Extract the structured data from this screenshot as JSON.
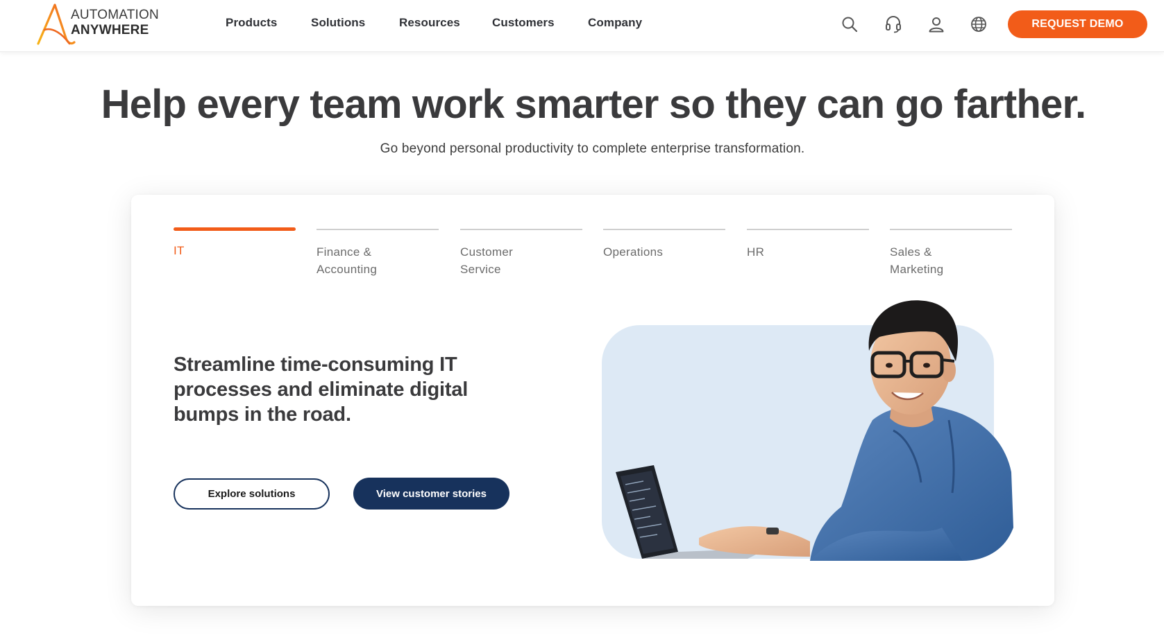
{
  "brand": {
    "logo_line1": "AUTOMATION",
    "logo_line2": "ANYWHERE",
    "accent_color": "#f25c19",
    "navy_color": "#17325c"
  },
  "nav": {
    "items": [
      {
        "label": "Products"
      },
      {
        "label": "Solutions"
      },
      {
        "label": "Resources"
      },
      {
        "label": "Customers"
      },
      {
        "label": "Company"
      }
    ],
    "icons": [
      "search-icon",
      "headset-icon",
      "user-icon",
      "globe-icon"
    ],
    "cta_label": "REQUEST DEMO"
  },
  "hero": {
    "title": "Help every team work smarter so they can go farther.",
    "subtitle": "Go beyond personal productivity to complete enterprise transformation."
  },
  "tabs": {
    "active_index": 0,
    "items": [
      {
        "label": "IT"
      },
      {
        "label": "Finance &\nAccounting"
      },
      {
        "label": "Customer\nService"
      },
      {
        "label": "Operations"
      },
      {
        "label": "HR"
      },
      {
        "label": "Sales &\nMarketing"
      }
    ]
  },
  "panel": {
    "headline": "Streamline time-consuming IT processes and eliminate digital bumps in the road.",
    "primary_button": "Explore solutions",
    "secondary_button": "View customer stories"
  }
}
